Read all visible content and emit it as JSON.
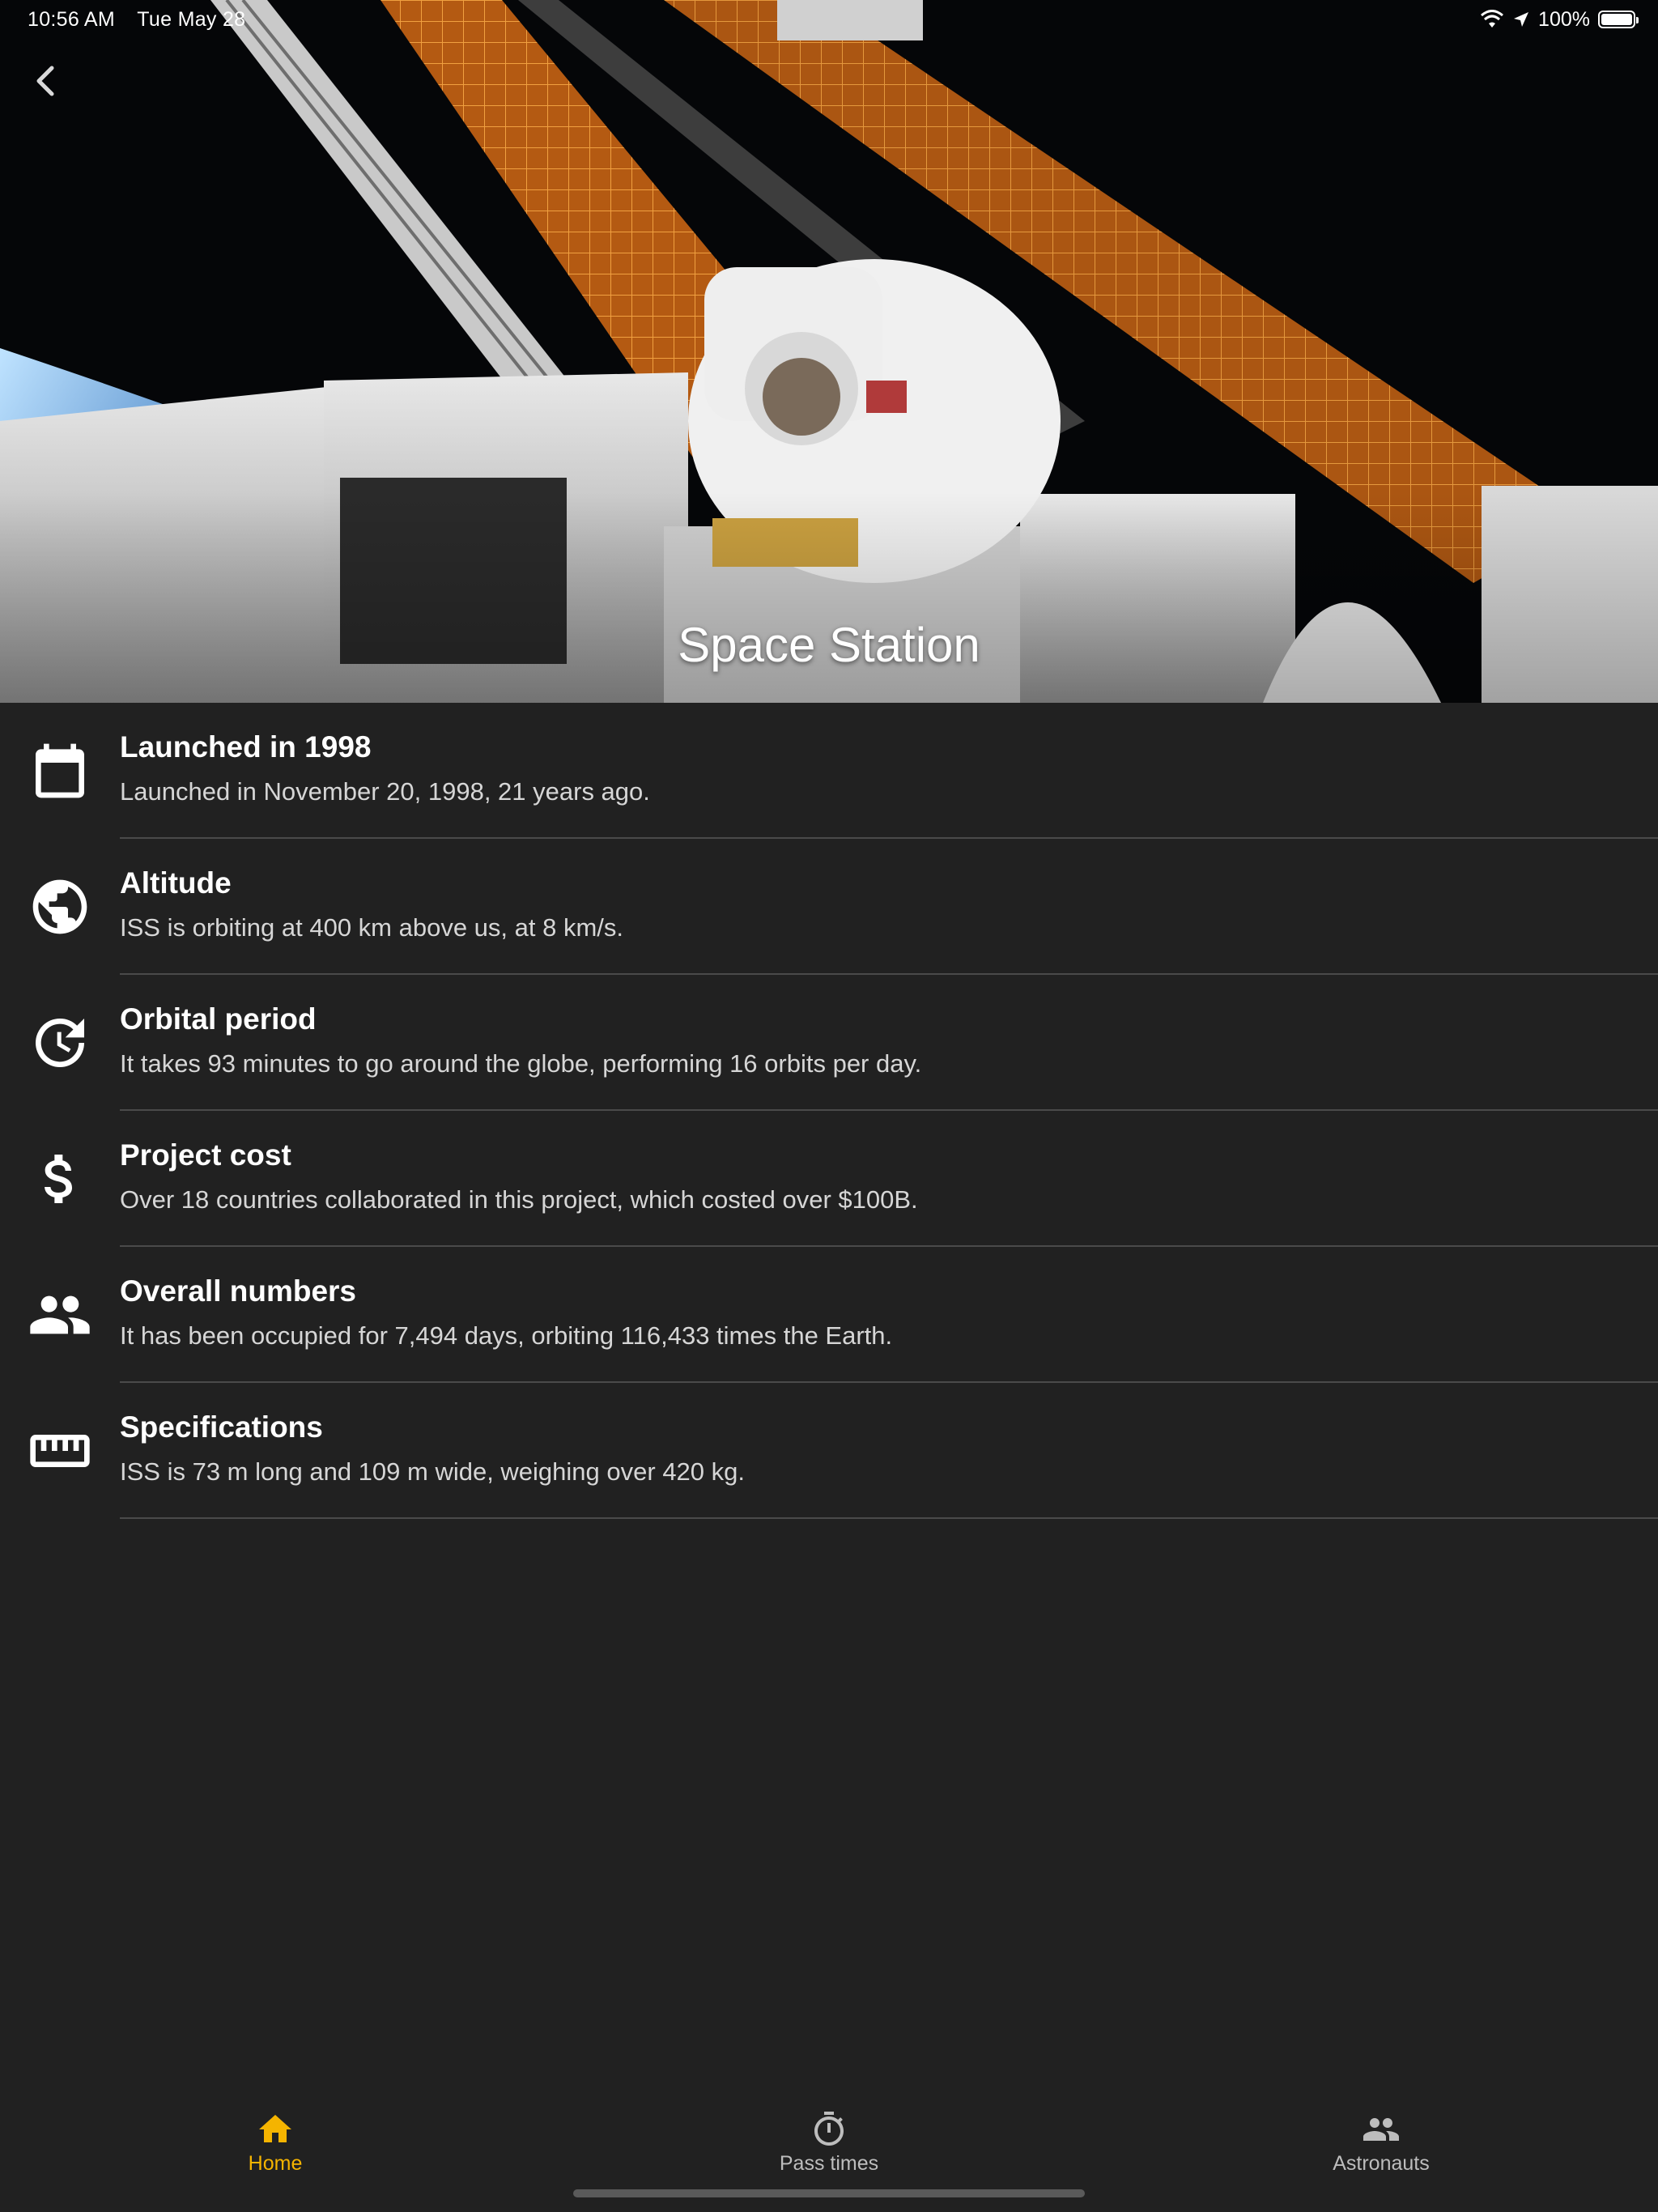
{
  "status_bar": {
    "time": "10:56 AM",
    "date": "Tue May 28",
    "battery": "100%"
  },
  "header": {
    "title": "Space Station"
  },
  "colors": {
    "background": "#212121",
    "accent": "#F5B400",
    "inactive": "#BDBDBD",
    "divider": "#4A4A4A"
  },
  "info_items": [
    {
      "icon": "calendar-icon",
      "title": "Launched in 1998",
      "description": "Launched in November 20, 1998, 21 years ago."
    },
    {
      "icon": "globe-icon",
      "title": "Altitude",
      "description": "ISS is orbiting at 400 km above us, at 8 km/s."
    },
    {
      "icon": "clock-refresh-icon",
      "title": "Orbital period",
      "description": "It takes 93 minutes to go around the globe, performing 16 orbits per day."
    },
    {
      "icon": "dollar-icon",
      "title": "Project cost",
      "description": "Over 18 countries collaborated in this project, which costed over $100B."
    },
    {
      "icon": "people-icon",
      "title": "Overall numbers",
      "description": "It has been occupied for 7,494 days, orbiting 116,433 times the Earth."
    },
    {
      "icon": "ruler-icon",
      "title": "Specifications",
      "description": "ISS is 73 m long and 109 m wide, weighing over 420 kg."
    }
  ],
  "bottom_nav": {
    "tabs": [
      {
        "label": "Home",
        "icon": "home-icon",
        "active": true
      },
      {
        "label": "Pass times",
        "icon": "timer-icon",
        "active": false
      },
      {
        "label": "Astronauts",
        "icon": "people-icon",
        "active": false
      }
    ]
  }
}
